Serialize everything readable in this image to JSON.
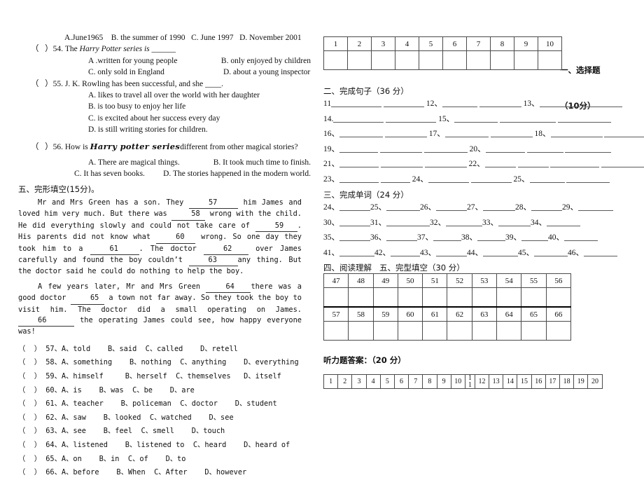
{
  "document": {
    "type": "english-exam-paper",
    "left_column": {
      "reading_questions": [
        {
          "id": "q53-options",
          "kind": "options-line",
          "text": "A.June1965    B. the summer of 1990   C. June 1997   D. November 2001",
          "indent": "indent-1"
        },
        {
          "id": "q54-stem",
          "kind": "stem",
          "bracket": "（   ）",
          "number": "54.",
          "text_before": " The ",
          "italic": "Harry Potter series is",
          "text_after": " ______"
        },
        {
          "id": "q54-opts-1",
          "kind": "two-col",
          "left": "A .written for young people",
          "right": "B. only enjoyed by children"
        },
        {
          "id": "q54-opts-2",
          "kind": "two-col",
          "left": "C. only sold in England",
          "right": "D. about a young inspector"
        },
        {
          "id": "q55-stem",
          "kind": "plain",
          "text": "（   ）55. J. K. Rowling has been successful, and she ____."
        },
        {
          "id": "q55-a",
          "kind": "opt",
          "text": "A. likes to travel all over the world with her daughter"
        },
        {
          "id": "q55-b",
          "kind": "opt",
          "text": "B. is too busy to enjoy her life"
        },
        {
          "id": "q55-c",
          "kind": "opt",
          "text": "C. is excited about her success every day"
        },
        {
          "id": "q55-d",
          "kind": "opt",
          "text": "D. is still writing stories for children."
        },
        {
          "id": "q56-stem",
          "kind": "script-stem",
          "prefix": "（   ）56. How is ",
          "script": "Harry potter series",
          "suffix": "different from other magical stories?"
        },
        {
          "id": "q56-opts-1",
          "kind": "two-col",
          "left": "A. There are magical things.",
          "right": "B. It took much time to finish."
        },
        {
          "id": "q56-opts-2",
          "kind": "two-col",
          "left": "C. It has seven books.",
          "right": "D. The stories happened in the modern world."
        }
      ],
      "cloze_heading": "五、完形填空(15分)。",
      "cloze_paragraphs": [
        {
          "id": "cloze-p1",
          "segments": [
            {
              "t": "text",
              "v": "Mr and Mrs Green has a son. They "
            },
            {
              "t": "blank",
              "v": "57",
              "w": "bw-70"
            },
            {
              "t": "text",
              "v": " him James and loved him very much. But there was "
            },
            {
              "t": "blank",
              "v": "58",
              "w": "bw-48"
            },
            {
              "t": "text",
              "v": " wrong with the child. He did everything slowly and could not take care of "
            },
            {
              "t": "blank",
              "v": "59",
              "w": "bw-60"
            },
            {
              "t": "text",
              "v": ". His parents did not know what "
            },
            {
              "t": "blank",
              "v": "60",
              "w": "bw-56"
            },
            {
              "t": "text",
              "v": " wrong. So one day they took him to a "
            },
            {
              "t": "blank",
              "v": "61",
              "w": "bw-70"
            },
            {
              "t": "text",
              "v": ". The doctor "
            },
            {
              "t": "blank",
              "v": "62",
              "w": "bw-64"
            },
            {
              "t": "text",
              "v": " over James carefully and found the boy couldn’t "
            },
            {
              "t": "blank",
              "v": "63",
              "w": "bw-70"
            },
            {
              "t": "text",
              "v": "any thing. But the doctor said he could do nothing to help the boy."
            }
          ]
        },
        {
          "id": "cloze-p2",
          "segments": [
            {
              "t": "text",
              "v": "A few years later, Mr and Mrs Green "
            },
            {
              "t": "blank",
              "v": "64",
              "w": "bw-64"
            },
            {
              "t": "text",
              "v": "there was a good doctor "
            },
            {
              "t": "blank",
              "v": "65",
              "w": "bw-48"
            },
            {
              "t": "text",
              "v": " a town not far away. So they took the boy to visit him. The doctor did a small operating on James. "
            },
            {
              "t": "blank",
              "v": "66",
              "w": "bw-80"
            },
            {
              "t": "text",
              "v": " the operating James could see, how happy everyone was!"
            }
          ]
        }
      ],
      "cloze_choices": [
        "（  ） 57、A、told    B、said  C、called    D、retell",
        "（  ） 58、A、something    B、nothing  C、anything    D、everything",
        "（  ） 59、A、himself     B、herself  C、themselves   D、itself",
        "（  ） 60、A、is    B、was  C、be    D、are",
        "（  ） 61、A、teacher    B、policeman  C、doctor    D、student",
        "（  ） 62、A、saw    B、looked  C、watched    D、see",
        "（  ） 63、A、see    B、feel  C、smell    D、touch",
        "（  ） 64、A、listened    B、listened to  C、heard    D、heard of",
        "（  ） 65、A、on    B、in  C、of    D、to",
        "（  ） 66、A、before    B、When  C、After    D、however"
      ]
    },
    "right_column": {
      "section_choice": {
        "heading_line1": "一、选择题",
        "heading_line2": "（10分）",
        "numbers": [
          "1",
          "2",
          "3",
          "4",
          "5",
          "6",
          "7",
          "8",
          "9",
          "10"
        ]
      },
      "section_sentences": {
        "heading": "二、完成句子（36 分）",
        "rows": [
          [
            {
              "num": "11",
              "sep": "",
              "blanks": [
                72,
                58
              ]
            },
            {
              "num": "12",
              "sep": "、",
              "blanks": [
                50,
                60
              ]
            },
            {
              "num": "13",
              "sep": "、",
              "blanks": [
                58,
                58
              ]
            }
          ],
          [
            {
              "num": "14",
              "sep": ".",
              "blanks": [
                72,
                72
              ]
            },
            {
              "num": "15",
              "sep": "、",
              "blanks": [
                62,
                80,
                76
              ]
            }
          ],
          [
            {
              "num": "16",
              "sep": "、",
              "blanks": [
                62,
                60
              ]
            },
            {
              "num": "17",
              "sep": "、",
              "blanks": [
                62,
                60
              ]
            },
            {
              "num": "18",
              "sep": "、",
              "blanks": [
                74,
                62
              ]
            }
          ],
          [
            {
              "num": "19",
              "sep": "、",
              "blanks": [
                55,
                60,
                62
              ]
            },
            {
              "num": "20",
              "sep": "、",
              "blanks": [
                56,
                52,
                66
              ]
            }
          ],
          [
            {
              "num": "21",
              "sep": "、",
              "blanks": [
                56,
                60,
                60
              ]
            },
            {
              "num": "22",
              "sep": "、",
              "blanks": [
                44,
                44,
                70,
                64
              ]
            }
          ],
          [
            {
              "num": "23",
              "sep": "、",
              "blanks": [
                56,
                42
              ]
            },
            {
              "num": "24",
              "sep": "、",
              "blanks": [
                58,
                58
              ]
            },
            {
              "num": "25",
              "sep": "、",
              "blanks": [
                50,
                62
              ]
            }
          ]
        ]
      },
      "section_words": {
        "heading": "三、完成单词（24 分）",
        "rows": [
          [
            {
              "num": "24",
              "blank": 44
            },
            {
              "num": "25",
              "blank": 48
            },
            {
              "num": "26",
              "blank": 44
            },
            {
              "num": "27",
              "blank": 46
            },
            {
              "num": "28",
              "blank": 44
            },
            {
              "num": "29",
              "blank": 50
            }
          ],
          [
            {
              "num": "30",
              "blank": 44
            },
            {
              "num": "31",
              "blank": 62
            },
            {
              "num": "32",
              "blank": 52
            },
            {
              "num": "33",
              "blank": 46
            },
            {
              "num": "34",
              "blank": 48
            },
            {
              "num": "",
              "blank": 0
            }
          ],
          [
            {
              "num": "35",
              "blank": 44
            },
            {
              "num": "36",
              "blank": 44
            },
            {
              "num": "37",
              "blank": 40
            },
            {
              "num": "38",
              "blank": 40
            },
            {
              "num": "39",
              "blank": 38
            },
            {
              "num": "40",
              "blank": 48
            }
          ],
          [
            {
              "num": "41",
              "blank": 50
            },
            {
              "num": "42",
              "blank": 42
            },
            {
              "num": "43",
              "blank": 44
            },
            {
              "num": "44",
              "blank": 50
            },
            {
              "num": "45",
              "blank": 48
            },
            {
              "num": "46",
              "blank": 48
            }
          ]
        ]
      },
      "section_reading": {
        "heading": "四、阅读理解   五、完型填空（30 分）",
        "row1": [
          "47",
          "48",
          "49",
          "50",
          "51",
          "52",
          "53",
          "54",
          "55",
          "56"
        ],
        "row2": [
          "57",
          "58",
          "59",
          "60",
          "61",
          "62",
          "63",
          "64",
          "65",
          "66"
        ]
      },
      "section_listening": {
        "heading": "听力题答案：（20 分）",
        "numbers": [
          "1",
          "2",
          "3",
          "4",
          "5",
          "6",
          "7",
          "8",
          "9",
          "10",
          "11",
          "12",
          "13",
          "14",
          "15",
          "16",
          "17",
          "18",
          "19",
          "20"
        ],
        "narrow_index": 10
      }
    }
  },
  "colors": {
    "ink": "#111111",
    "rule": "#4a4a4a",
    "thick_rule": "#000000",
    "paper": "#ffffff"
  }
}
